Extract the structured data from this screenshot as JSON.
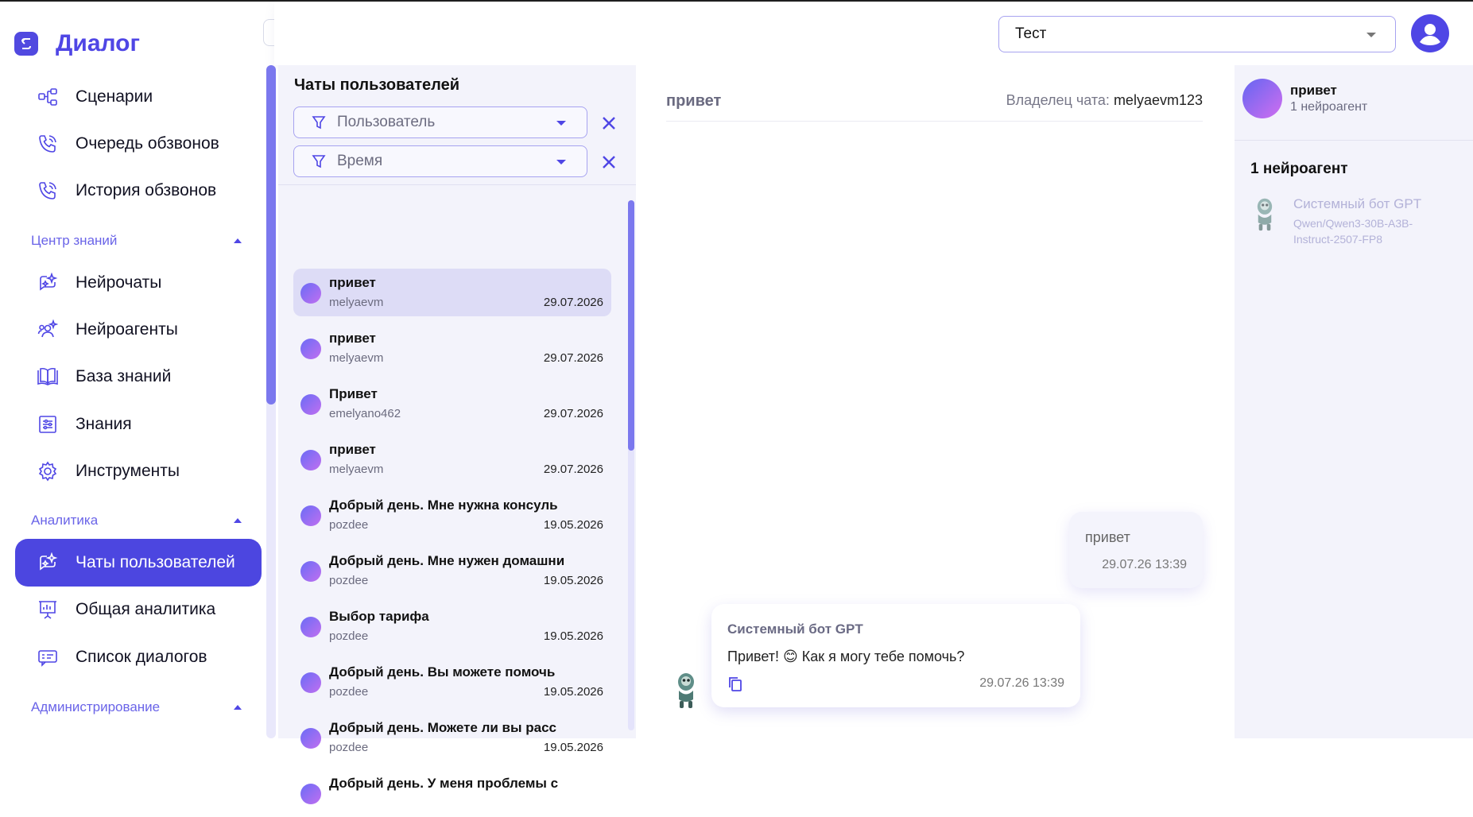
{
  "app": {
    "name": "Диалог"
  },
  "sidebar": {
    "items_top": [
      {
        "label": "Сценарии",
        "icon": "scenarios-icon"
      },
      {
        "label": "Очередь обзвонов",
        "icon": "phone-queue-icon"
      },
      {
        "label": "История обзвонов",
        "icon": "phone-history-icon"
      }
    ],
    "sections": [
      {
        "title": "Центр знаний",
        "items": [
          {
            "label": "Нейрочаты",
            "icon": "neurochats-icon"
          },
          {
            "label": "Нейроагенты",
            "icon": "neuroagents-icon"
          },
          {
            "label": "База знаний",
            "icon": "book-icon"
          },
          {
            "label": "Знания",
            "icon": "knowledge-icon"
          },
          {
            "label": "Инструменты",
            "icon": "gear-icon"
          }
        ]
      },
      {
        "title": "Аналитика",
        "items": [
          {
            "label": "Чаты пользователей",
            "icon": "user-chats-icon",
            "active": true
          },
          {
            "label": "Общая аналитика",
            "icon": "analytics-icon"
          },
          {
            "label": "Список диалогов",
            "icon": "dialog-list-icon"
          }
        ]
      },
      {
        "title": "Администрирование",
        "items": []
      }
    ]
  },
  "header": {
    "project": "Тест"
  },
  "chats_panel": {
    "title": "Чаты пользователей",
    "filter_user": "Пользователь",
    "filter_time": "Время",
    "chats": [
      {
        "title": "привет",
        "user": "melyaevm",
        "date": "29.07.2026",
        "active": true
      },
      {
        "title": "привет",
        "user": "melyaevm",
        "date": "29.07.2026"
      },
      {
        "title": "Привет",
        "user": "emelyano462",
        "date": "29.07.2026"
      },
      {
        "title": "привет",
        "user": "melyaevm",
        "date": "29.07.2026"
      },
      {
        "title": "Добрый день. Мне нужна консуль",
        "user": "pozdee",
        "date": "19.05.2026"
      },
      {
        "title": "Добрый день. Мне нужен домашни",
        "user": "pozdee",
        "date": "19.05.2026"
      },
      {
        "title": "Выбор тарифа",
        "user": "pozdee",
        "date": "19.05.2026"
      },
      {
        "title": "Добрый день. Вы можете помочь",
        "user": "pozdee",
        "date": "19.05.2026"
      },
      {
        "title": "Добрый день. Можете ли вы расс",
        "user": "pozdee",
        "date": "19.05.2026"
      },
      {
        "title": "Добрый день. У меня проблемы с",
        "user": "",
        "date": ""
      }
    ]
  },
  "chat": {
    "title": "привет",
    "owner_label": "Владелец чата:",
    "owner": "melyaevm123",
    "messages": [
      {
        "from": "user",
        "text": "привет",
        "time": "29.07.26 13:39"
      },
      {
        "from": "bot",
        "name": "Системный бот GPT",
        "text": "Привет! 😊 Как я могу тебе помочь?",
        "time": "29.07.26 13:39"
      }
    ]
  },
  "right_panel": {
    "chat_title": "привет",
    "agents_count": "1 нейроагент",
    "section_title": "1 нейроагент",
    "agents": [
      {
        "name": "Системный бот GPT",
        "model": "Qwen/Qwen3-30B-A3B-Instruct-2507-FP8"
      }
    ]
  },
  "colors": {
    "accent": "#4f46e5",
    "panel_bg": "#f3f3fb",
    "active_item": "#4c46e0"
  }
}
